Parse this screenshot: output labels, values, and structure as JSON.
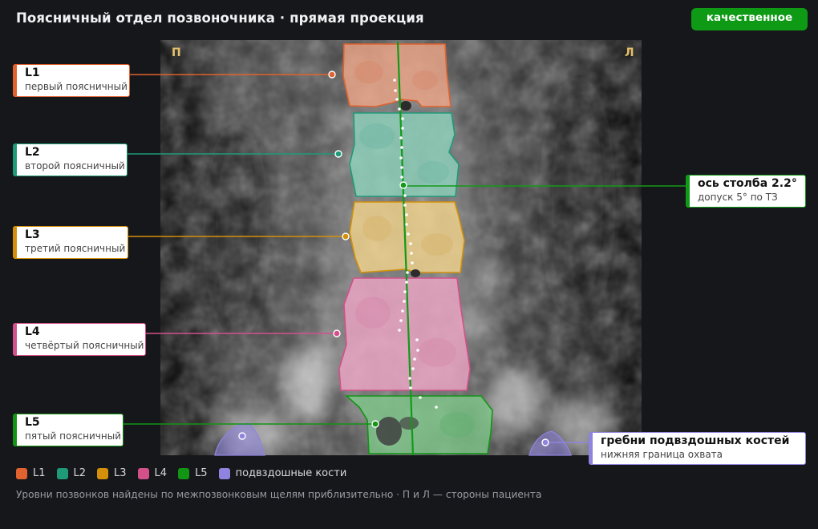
{
  "title": "Поясничный отдел позвоночника · прямая проекция",
  "quality_badge": "качественное",
  "side_markers": {
    "right": "П",
    "left": "Л"
  },
  "vertebrae": [
    {
      "key": "L1",
      "label": "L1",
      "description": "первый поясничный",
      "color": "#e0622e"
    },
    {
      "key": "L2",
      "label": "L2",
      "description": "второй поясничный",
      "color": "#1f9a78"
    },
    {
      "key": "L3",
      "label": "L3",
      "description": "третий поясничный",
      "color": "#d4900a"
    },
    {
      "key": "L4",
      "label": "L4",
      "description": "четвёртый поясничный",
      "color": "#d4508a"
    },
    {
      "key": "L5",
      "label": "L5",
      "description": "пятый поясничный",
      "color": "#129414"
    }
  ],
  "axis": {
    "label": "ось столба 2.2°",
    "note": "допуск 5° по ТЗ",
    "angle_deg": 2.2,
    "color": "#119a18"
  },
  "iliac": {
    "label": "гребни подвздошных костей",
    "note": "нижняя граница охвата",
    "color": "#8e84e0"
  },
  "legend": [
    {
      "name": "L1",
      "color": "#e0622e"
    },
    {
      "name": "L2",
      "color": "#1f9a78"
    },
    {
      "name": "L3",
      "color": "#d4900a"
    },
    {
      "name": "L4",
      "color": "#d4508a"
    },
    {
      "name": "L5",
      "color": "#129414"
    },
    {
      "name": "подвздошные кости",
      "color": "#8e84e0"
    }
  ],
  "footnote": "Уровни позвонков найдены по межпозвонковым щелям приблизительно · П и Л — стороны пациента"
}
